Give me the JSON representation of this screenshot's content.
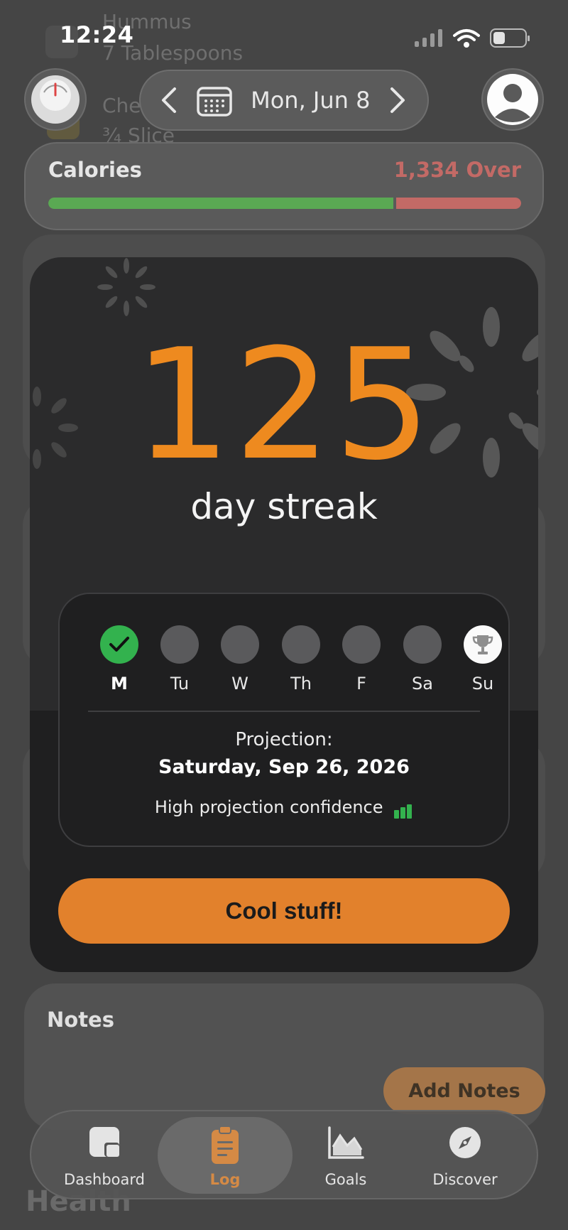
{
  "status_bar": {
    "time": "12:24"
  },
  "background_log": {
    "items": [
      {
        "name": "Hummus",
        "amount": "7 Tablespoons"
      },
      {
        "name": "Che",
        "amount": "¾ Slice"
      }
    ],
    "section_heading": "Health"
  },
  "header": {
    "date": "Mon, Jun 8"
  },
  "calories": {
    "title": "Calories",
    "status": "1,334 Over",
    "progress_fraction": 0.73
  },
  "streak": {
    "count": "125",
    "label": "day streak",
    "days": [
      {
        "label": "M",
        "state": "done"
      },
      {
        "label": "Tu",
        "state": "pending"
      },
      {
        "label": "W",
        "state": "pending"
      },
      {
        "label": "Th",
        "state": "pending"
      },
      {
        "label": "F",
        "state": "pending"
      },
      {
        "label": "Sa",
        "state": "pending"
      },
      {
        "label": "Su",
        "state": "trophy"
      }
    ],
    "projection_label": "Projection:",
    "projection_date": "Saturday, Sep 26, 2026",
    "confidence_text": "High projection confidence",
    "confidence_level": "high",
    "button_label": "Cool stuff!"
  },
  "notes": {
    "title": "Notes",
    "button_label": "Add Notes"
  },
  "tabbar": {
    "tabs": [
      {
        "label": "Dashboard",
        "icon": "dashboard-icon"
      },
      {
        "label": "Log",
        "icon": "clipboard-icon",
        "active": true
      },
      {
        "label": "Goals",
        "icon": "chart-icon"
      },
      {
        "label": "Discover",
        "icon": "compass-icon"
      }
    ]
  },
  "colors": {
    "accent_orange": "#ee8a1f",
    "button_orange": "#e2812c",
    "progress_green": "#5aa953",
    "over_red": "#c36a66",
    "check_green": "#33b24e"
  }
}
